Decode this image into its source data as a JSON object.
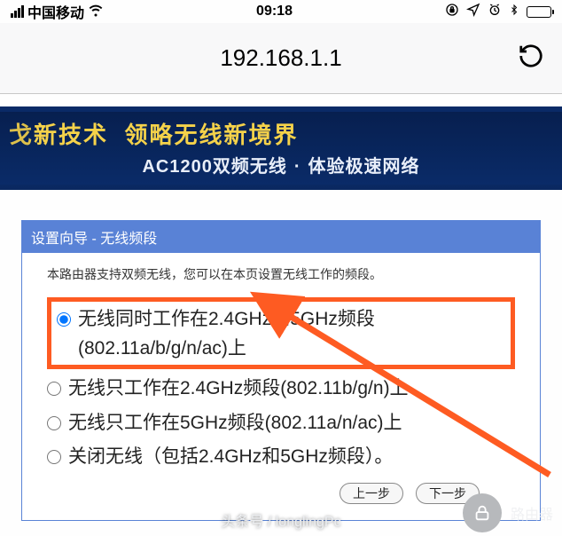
{
  "status": {
    "carrier": "中国移动",
    "time": "09:18"
  },
  "address_bar": {
    "url": "192.168.1.1"
  },
  "banner": {
    "title_left": "新技术",
    "title_right": "领略无线新境界",
    "sub_left": "AC1200双频无线",
    "sub_right": "体验极速网络"
  },
  "panel": {
    "header": "设置向导 - 无线频段",
    "description": "本路由器支持双频无线，您可以在本页设置无线工作的频段。",
    "options": [
      {
        "label": "无线同时工作在2.4GHz和5GHz频段(802.11a/b/g/n/ac)上",
        "selected": true
      },
      {
        "label": "无线只工作在2.4GHz频段(802.11b/g/n)上",
        "selected": false
      },
      {
        "label": "无线只工作在5GHz频段(802.11a/n/ac)上",
        "selected": false
      },
      {
        "label": "关闭无线（包括2.4GHz和5GHz频段）。",
        "selected": false
      }
    ],
    "buttons": {
      "prev": "上一步",
      "next": "下一步"
    }
  },
  "watermark": {
    "badge": "路由器",
    "text": "头条号 / longlingPc"
  }
}
